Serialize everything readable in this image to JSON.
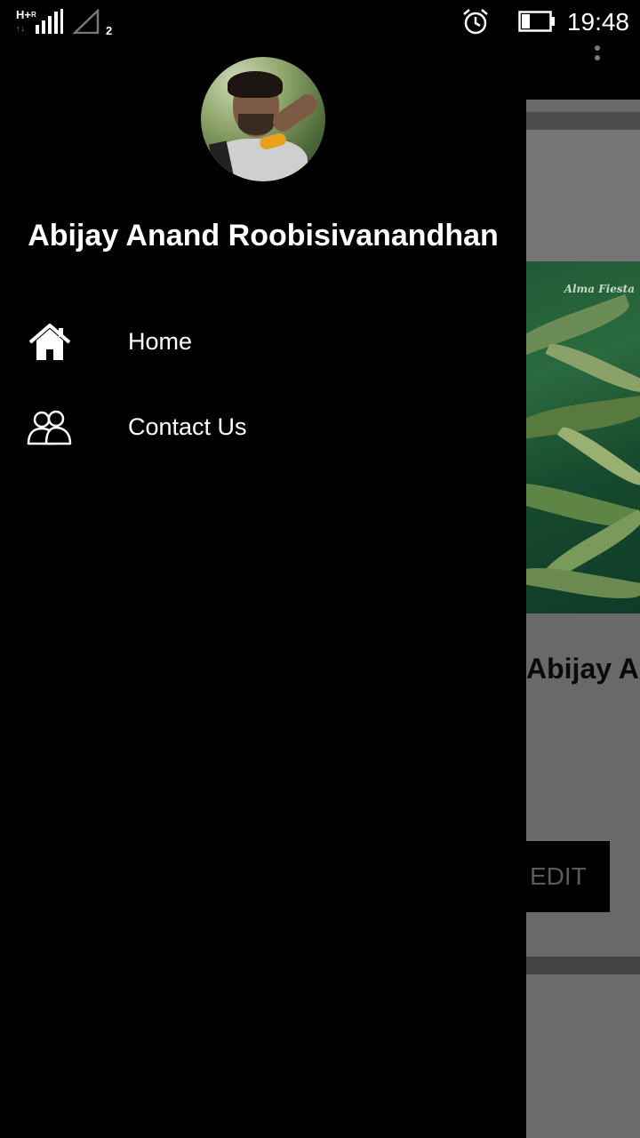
{
  "status_bar": {
    "network": "H+",
    "roaming": "R",
    "data_arrows": "↑↓",
    "sim_slot": "2",
    "time": "19:48",
    "battery_level": 0.25,
    "icons": [
      "signal-bars-icon",
      "signal-empty-icon",
      "alarm-icon",
      "battery-icon"
    ]
  },
  "drawer": {
    "user_name": "Abijay Anand Roobisivanandhan",
    "menu": [
      {
        "label": "Home",
        "icon": "home-icon"
      },
      {
        "label": "Contact Us",
        "icon": "contacts-icon"
      }
    ]
  },
  "background": {
    "banner_logo": "Alma Fiesta",
    "profile_name": "Abijay Anand Roobisivanandhan",
    "button_label": "EDIT"
  },
  "colors": {
    "drawer_bg": "#000000",
    "scrim": "#696969",
    "text": "#ffffff"
  }
}
